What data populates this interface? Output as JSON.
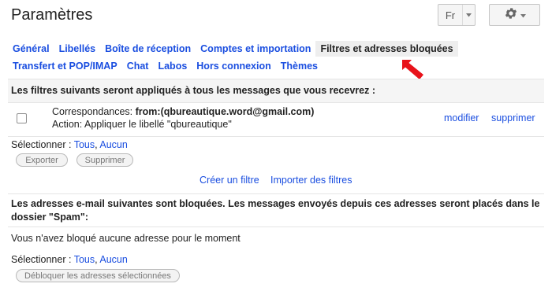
{
  "page": {
    "title": "Paramètres"
  },
  "header": {
    "language_label": "Fr"
  },
  "tabs": {
    "row1": [
      {
        "label": "Général"
      },
      {
        "label": "Libellés"
      },
      {
        "label": "Boîte de réception"
      },
      {
        "label": "Comptes et importation"
      },
      {
        "label": "Filtres et adresses bloquées",
        "active": true
      }
    ],
    "row2": [
      {
        "label": "Transfert et POP/IMAP"
      },
      {
        "label": "Chat"
      },
      {
        "label": "Labos"
      },
      {
        "label": "Hors connexion"
      },
      {
        "label": "Thèmes"
      }
    ]
  },
  "filters": {
    "heading": "Les filtres suivants seront appliqués à tous les messages que vous recevrez :",
    "items": [
      {
        "criteria_label": "Correspondances: ",
        "criteria_value": "from:(qbureautique.word@gmail.com)",
        "action_text": "Action: Appliquer le libellé \"qbureautique\"",
        "edit_label": "modifier",
        "delete_label": "supprimer"
      }
    ],
    "select_prefix": "Sélectionner : ",
    "select_all": "Tous",
    "select_sep": ", ",
    "select_none": "Aucun",
    "export_label": "Exporter",
    "delete_label": "Supprimer",
    "create_filter_label": "Créer un filtre",
    "import_filters_label": "Importer des filtres"
  },
  "blocked": {
    "heading": "Les adresses e-mail suivantes sont bloquées. Les messages envoyés depuis ces adresses seront placés dans le dossier \"Spam\":",
    "empty_text": "Vous n'avez bloqué aucune adresse pour le moment",
    "select_prefix": "Sélectionner : ",
    "select_all": "Tous",
    "select_sep": ", ",
    "select_none": "Aucun",
    "unblock_label": "Débloquer les adresses sélectionnées"
  },
  "colors": {
    "link": "#1a4ee0",
    "active_tab_bg": "#eeeeee",
    "annotation_arrow": "#e8121a"
  },
  "icons": {
    "settings": "gear-icon",
    "dropdown": "chevron-down-icon",
    "annotation": "red-arrow-icon"
  }
}
